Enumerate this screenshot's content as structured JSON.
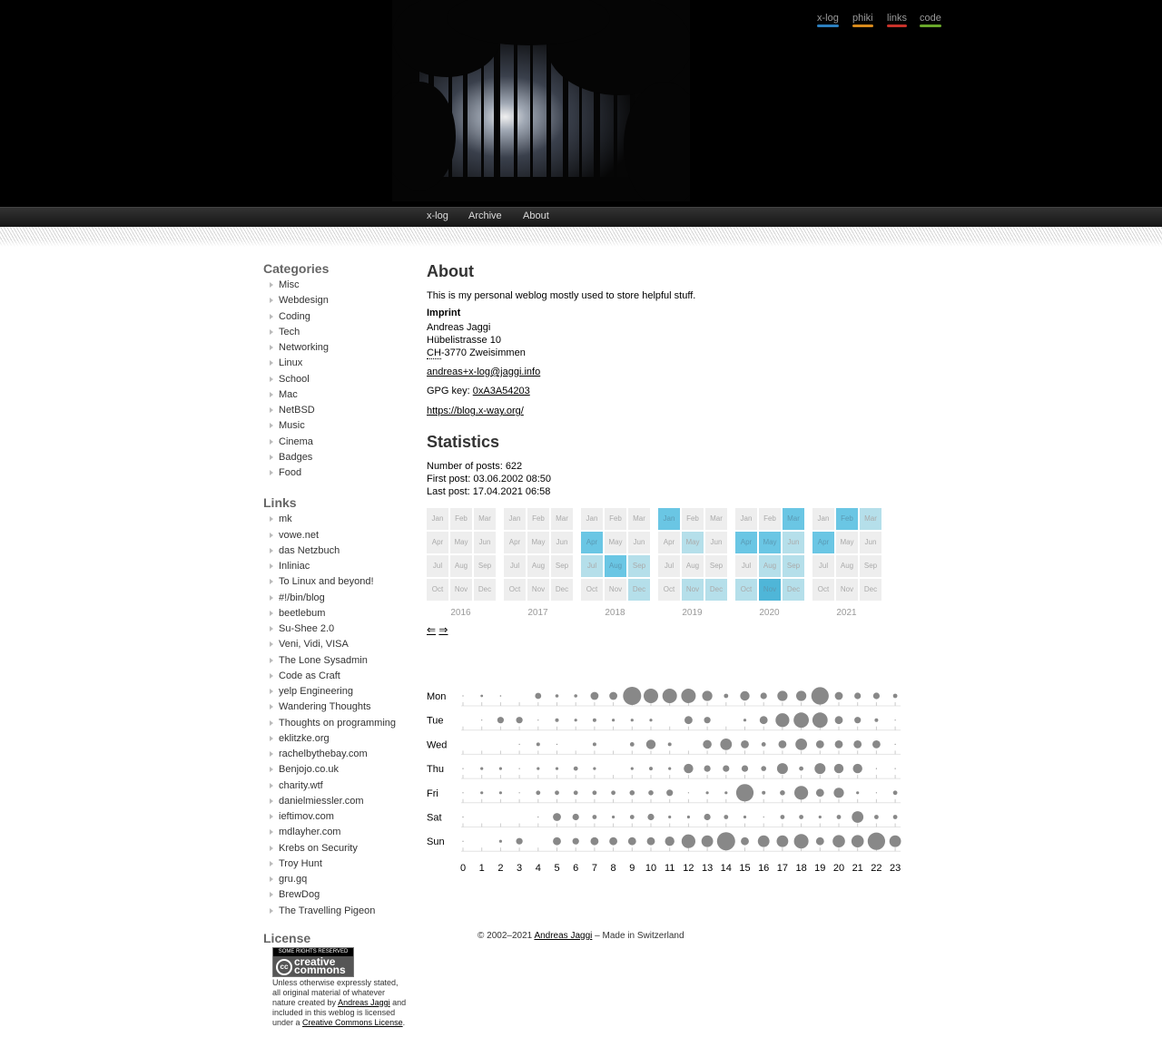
{
  "header": {
    "top_links": [
      {
        "label": "x-log",
        "color": "#2c7fbf"
      },
      {
        "label": "phiki",
        "color": "#d88a1c"
      },
      {
        "label": "links",
        "color": "#c8322a"
      },
      {
        "label": "code",
        "color": "#6aa82a"
      }
    ]
  },
  "nav": {
    "items": [
      "x-log",
      "Archive",
      "About"
    ]
  },
  "sidebar": {
    "categories_title": "Categories",
    "categories": [
      "Misc",
      "Webdesign",
      "Coding",
      "Tech",
      "Networking",
      "Linux",
      "School",
      "Mac",
      "NetBSD",
      "Music",
      "Cinema",
      "Badges",
      "Food"
    ],
    "links_title": "Links",
    "links": [
      "mk",
      "vowe.net",
      "das Netzbuch",
      "Inliniac",
      "To Linux and beyond!",
      "#!/bin/blog",
      "beetlebum",
      "Su-Shee 2.0",
      "Veni, Vidi, VISA",
      "The Lone Sysadmin",
      "Code as Craft",
      "yelp Engineering",
      "Wandering Thoughts",
      "Thoughts on programming",
      "eklitzke.org",
      "rachelbythebay.com",
      "Benjojo.co.uk",
      "charity.wtf",
      "danielmiessler.com",
      "ieftimov.com",
      "mdlayher.com",
      "Krebs on Security",
      "Troy Hunt",
      "gru.gq",
      "BrewDog",
      "The Travelling Pigeon"
    ],
    "license_title": "License",
    "badge_top": "SOME RIGHTS RESERVED",
    "badge_cc": "cc",
    "badge_word": "creative commons",
    "license_text_1": "Unless otherwise expressly stated, all original material of whatever nature created by ",
    "license_author": "Andreas Jaggi",
    "license_text_2": " and included in this weblog is licensed under a ",
    "license_link": "Creative Commons License",
    "license_text_3": "."
  },
  "about": {
    "title": "About",
    "intro": "This is my personal weblog mostly used to store helpful stuff.",
    "imprint_label": "Imprint",
    "name": "Andreas Jaggi",
    "street": "Hübelistrasse 10",
    "country_abbr": "CH",
    "city": "-3770 Zweisimmen",
    "email": "andreas+x-log@jaggi.info",
    "gpg_label": "GPG key: ",
    "gpg_key": "0xA3A54203",
    "url": "https://blog.x-way.org/"
  },
  "stats": {
    "title": "Statistics",
    "posts": "Number of posts: 622",
    "first": "First post: 03.06.2002 08:50",
    "last": "Last post: 17.04.2021 06:58",
    "prev_arrow": "⇐",
    "next_arrow": "⇒",
    "month_labels": [
      "Jan",
      "Feb",
      "Mar",
      "Apr",
      "May",
      "Jun",
      "Jul",
      "Aug",
      "Sep",
      "Oct",
      "Nov",
      "Dec"
    ],
    "years": [
      {
        "year": "2016",
        "levels": [
          0,
          0,
          0,
          0,
          0,
          0,
          0,
          0,
          0,
          0,
          0,
          0
        ]
      },
      {
        "year": "2017",
        "levels": [
          0,
          0,
          0,
          0,
          0,
          0,
          0,
          0,
          0,
          0,
          0,
          0
        ]
      },
      {
        "year": "2018",
        "levels": [
          0,
          0,
          0,
          2,
          0,
          0,
          1,
          2,
          1,
          0,
          0,
          1
        ]
      },
      {
        "year": "2019",
        "levels": [
          2,
          0,
          0,
          0,
          1,
          0,
          0,
          0,
          0,
          0,
          1,
          1
        ]
      },
      {
        "year": "2020",
        "levels": [
          0,
          0,
          2,
          2,
          2,
          1,
          0,
          1,
          1,
          1,
          3,
          1
        ]
      },
      {
        "year": "2021",
        "levels": [
          0,
          2,
          1,
          2,
          0,
          0,
          0,
          0,
          0,
          0,
          0,
          0
        ]
      }
    ],
    "punchcard": {
      "days": [
        "Mon",
        "Tue",
        "Wed",
        "Thu",
        "Fri",
        "Sat",
        "Sun"
      ],
      "hours": [
        "0",
        "1",
        "2",
        "3",
        "4",
        "5",
        "6",
        "7",
        "8",
        "9",
        "10",
        "11",
        "12",
        "13",
        "14",
        "15",
        "16",
        "17",
        "18",
        "19",
        "20",
        "21",
        "22",
        "23"
      ],
      "radius": [
        [
          0.6,
          1.4,
          0.8,
          0,
          3.4,
          1.8,
          1.8,
          4.4,
          4.4,
          10,
          8,
          8,
          8,
          5.6,
          2.4,
          5.2,
          3.6,
          5.6,
          5.6,
          9.6,
          4.4,
          3.6,
          3.6,
          2.4
        ],
        [
          0,
          0.6,
          3.6,
          3.6,
          0.6,
          2,
          1.6,
          2,
          1.6,
          1.6,
          1.6,
          0,
          4.4,
          3.6,
          0,
          1.6,
          4.4,
          7.6,
          8.4,
          8.4,
          4.4,
          3.6,
          2,
          0.6
        ],
        [
          0,
          0,
          0,
          0.6,
          2,
          0.6,
          0,
          2,
          0,
          2.4,
          5.2,
          2,
          0,
          4.8,
          6.4,
          4.4,
          2.4,
          4.4,
          6.4,
          4.4,
          4.4,
          4.4,
          4.4,
          0.6
        ],
        [
          0.6,
          1.6,
          1.6,
          0.6,
          1.6,
          1.6,
          2.4,
          1.6,
          0,
          1.6,
          2,
          1.6,
          5.2,
          3.6,
          3.6,
          3.6,
          2.8,
          6,
          2.4,
          6,
          5.2,
          5.2,
          0.6,
          0.6
        ],
        [
          0.6,
          1.6,
          1.6,
          0.6,
          2.4,
          2.4,
          2.4,
          2.4,
          2.4,
          2.8,
          2.8,
          3.6,
          0.6,
          1.6,
          1.6,
          9.6,
          2,
          2.8,
          7.6,
          4.4,
          5.6,
          1.6,
          0.6,
          2.4
        ],
        [
          0.6,
          0,
          0,
          0,
          0.6,
          4.4,
          3.6,
          2.4,
          1.6,
          2.4,
          3.6,
          1.6,
          1.6,
          3.6,
          2.4,
          1.6,
          0.6,
          2.4,
          2.4,
          1.6,
          2.4,
          6.4,
          2.4,
          2.4
        ],
        [
          0.6,
          0,
          1.6,
          3.6,
          0,
          4.4,
          3.6,
          4.4,
          4.4,
          4.4,
          4.4,
          5.2,
          7.6,
          6.4,
          10,
          4.4,
          6.4,
          6.4,
          8,
          4.4,
          6.8,
          6.8,
          9.6,
          6.4
        ]
      ]
    }
  },
  "footer": {
    "prefix": "© 2002–2021 ",
    "author": "Andreas Jaggi",
    "suffix": " – Made in Switzerland"
  },
  "colors": {
    "heat_level_1": "#b5dfea",
    "heat_level_2": "#6ac6e4",
    "heat_level_3": "#4fb6d8",
    "heat_empty": "#eeeeee",
    "bubble": "#888888"
  }
}
